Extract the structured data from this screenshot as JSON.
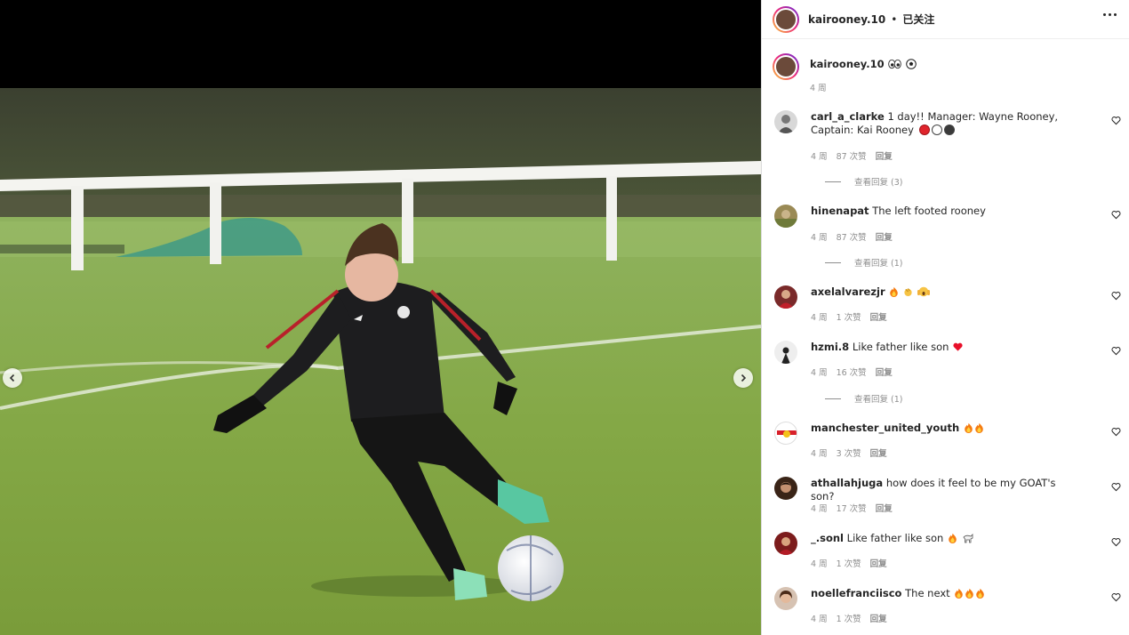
{
  "header": {
    "username": "kairooney.10",
    "separator": "•",
    "follow_status": "已关注",
    "more_icon": "more-horizontal-icon"
  },
  "caption": {
    "username": "kairooney.10",
    "emojis": [
      "eyes",
      "soccer-ball"
    ],
    "time": "4 周"
  },
  "comments": [
    {
      "username": "carl_a_clarke",
      "text": "1 day!! Manager: Wayne Rooney, Captain: Kai Rooney",
      "trailing": [
        "red-circle",
        "white-circle",
        "black-circle"
      ],
      "time": "4 周",
      "likes": "87 次赞",
      "reply": "回复",
      "view_replies": "查看回复 (3)"
    },
    {
      "username": "hinenapat",
      "text": "The left footed rooney",
      "time": "4 周",
      "likes": "87 次赞",
      "reply": "回复",
      "view_replies": "查看回复 (1)"
    },
    {
      "username": "axelalvarezjr",
      "text": "",
      "trailing": [
        "fire",
        "clap",
        "scream"
      ],
      "time": "4 周",
      "likes": "1 次赞",
      "reply": "回复"
    },
    {
      "username": "hzmi.8",
      "text": "Like father like son",
      "trailing": [
        "red-heart"
      ],
      "time": "4 周",
      "likes": "16 次赞",
      "reply": "回复",
      "view_replies": "查看回复 (1)"
    },
    {
      "username": "manchester_united_youth",
      "text": "",
      "trailing": [
        "fire",
        "fire"
      ],
      "time": "4 周",
      "likes": "3 次赞",
      "reply": "回复"
    },
    {
      "username": "athallahjuga",
      "text": "how does it feel to be my GOAT's son?",
      "time": "4 周",
      "likes": "17 次赞",
      "reply": "回复"
    },
    {
      "username": "_.sonl",
      "text": "Like father like son",
      "trailing": [
        "fire",
        "goat"
      ],
      "time": "4 周",
      "likes": "1 次赞",
      "reply": "回复"
    },
    {
      "username": "noellefranciisco",
      "text": "The next",
      "trailing": [
        "fire",
        "fire",
        "fire"
      ],
      "time": "4 周",
      "likes": "1 次赞",
      "reply": "回复"
    }
  ],
  "media": {
    "prev_icon": "chevron-left-icon",
    "next_icon": "chevron-right-icon"
  }
}
